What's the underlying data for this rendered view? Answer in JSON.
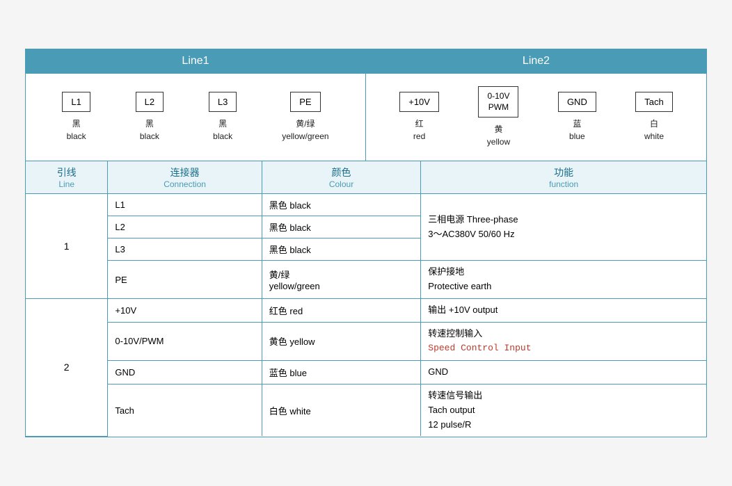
{
  "header": {
    "line1_label": "Line1",
    "line2_label": "Line2"
  },
  "line1_connectors": [
    {
      "id": "L1",
      "zh": "黑",
      "en": "black"
    },
    {
      "id": "L2",
      "zh": "黑",
      "en": "black"
    },
    {
      "id": "L3",
      "zh": "黑",
      "en": "black"
    },
    {
      "id": "PE",
      "zh": "黄/绿",
      "en": "yellow/green"
    }
  ],
  "line2_connectors": [
    {
      "id": "+10V",
      "zh": "红",
      "en": "red"
    },
    {
      "id": "0-10V\nPWM",
      "zh": "黄",
      "en": "yellow"
    },
    {
      "id": "GND",
      "zh": "蓝",
      "en": "blue"
    },
    {
      "id": "Tach",
      "zh": "白",
      "en": "white"
    }
  ],
  "table_headers": {
    "col1_zh": "引线",
    "col1_en": "Line",
    "col2_zh": "连接器",
    "col2_en": "Connection",
    "col3_zh": "颜色",
    "col3_en": "Colour",
    "col4_zh": "功能",
    "col4_en": "function"
  },
  "table_rows": [
    {
      "line": "1",
      "rowspan": 4,
      "entries": [
        {
          "connection": "L1",
          "color": "黑色 black",
          "function": "三相电源 Three-phase\n3～AC380V 50/60 Hz",
          "rowspan": 3
        },
        {
          "connection": "L2",
          "color": "黑色 black",
          "function": null
        },
        {
          "connection": "L3",
          "color": "黑色 black",
          "function": null
        },
        {
          "connection": "PE",
          "color": "黄/绿\nyellow/green",
          "function": "保护接地\nProtective earth"
        }
      ]
    },
    {
      "line": "2",
      "rowspan": 4,
      "entries": [
        {
          "connection": "+10V",
          "color": "红色 red",
          "function": "输出 +10V output"
        },
        {
          "connection": "0-10V/PWM",
          "color": "黄色 yellow",
          "function_parts": [
            "转速控制输入",
            "Speed Control Input"
          ],
          "highlight": true
        },
        {
          "connection": "GND",
          "color": "蓝色 blue",
          "function": "GND"
        },
        {
          "connection": "Tach",
          "color": "白色 white",
          "function": "转速信号输出\nTach output\n12 pulse/R"
        }
      ]
    }
  ]
}
